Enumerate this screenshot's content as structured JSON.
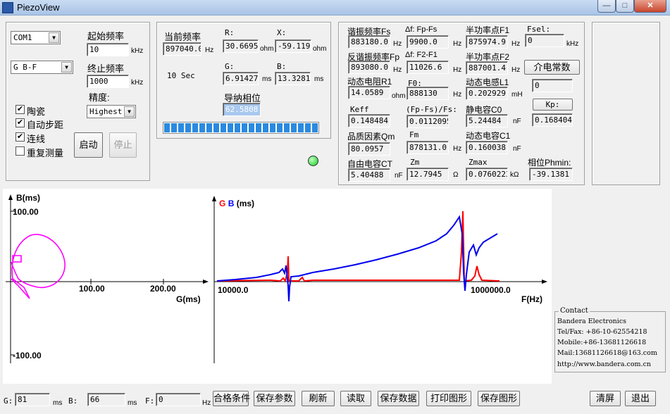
{
  "window": {
    "title": "PiezoView",
    "minimize": "—",
    "maximize": "□",
    "close": "✕"
  },
  "controls": {
    "port": "COM1",
    "mode": "G B-F",
    "start_freq_label": "起始频率",
    "start_freq_value": "10",
    "start_freq_unit": "kHz",
    "end_freq_label": "终止频率",
    "end_freq_value": "1000",
    "end_freq_unit": "kHz",
    "precision_label": "精度:",
    "precision_value": "Highest",
    "checkboxes": [
      {
        "label": "陶瓷",
        "checked": true
      },
      {
        "label": "自动步距",
        "checked": true
      },
      {
        "label": "连线",
        "checked": true
      },
      {
        "label": "重复测量",
        "checked": false
      }
    ],
    "start_button": "启动",
    "stop_button": "停止"
  },
  "measure": {
    "current_freq_label": "当前频率",
    "current_freq_value": "897040.0",
    "current_freq_unit": "Hz",
    "r_label": "R:",
    "r_value": "30.6695",
    "r_unit": "ohm",
    "x_label": "X:",
    "x_value": "-59.1191",
    "x_unit": "ohm",
    "time_text": "10 Sec",
    "g_label": "G:",
    "g_value": "6.91427",
    "g_unit": "ms",
    "b_label": "B:",
    "b_value": "13.3281",
    "b_unit": "ms",
    "phase_label": "导纳相位",
    "phase_value": "62.5808",
    "progress_percent": 100,
    "status_led_color": "#11cc22"
  },
  "params": {
    "fs_label": "谐振频率Fs",
    "fs_value": "883180.0",
    "fs_unit": "Hz",
    "df1_label": "Δf: Fp-Fs",
    "df1_value": "9900.0",
    "df1_unit": "Hz",
    "f1_label": "半功率点F1",
    "f1_value": "875974.9",
    "f1_unit": "Hz",
    "fsel_label": "Fsel:",
    "fsel_value": "0",
    "fsel_unit": "kHz",
    "fp_label": "反谐振频率Fp",
    "fp_value": "893080.0",
    "fp_unit": "Hz",
    "df2_label": "Δf: F2-F1",
    "df2_value": "11026.6",
    "df2_unit": "Hz",
    "f2_label": "半功率点F2",
    "f2_value": "887001.4",
    "f2_unit": "Hz",
    "dielectric_button": "介电常数",
    "dielectric_value": "0",
    "r1_label": "动态电阻R1",
    "r1_value": "14.0589",
    "r1_unit": "ohm",
    "f0_label": "F0:",
    "f0_value": "888130",
    "f0_unit": "Hz",
    "l1_label": "动态电感L1",
    "l1_value": "0.202929",
    "l1_unit": "mH",
    "kp_button": "Kp:",
    "kp_value": "0.168404",
    "keff_label": "Keff",
    "keff_value": "0.148484",
    "ratio_label": "(Fp-Fs)/Fs:",
    "ratio_value": "0.0112095",
    "c0_label": "静电容C0",
    "c0_value": "5.24484",
    "c0_unit": "nF",
    "qm_label": "品质因素Qm",
    "qm_value": "80.0957",
    "fm_label": "Fm",
    "fm_value": "878131.0",
    "fm_unit": "Hz",
    "c1_label": "动态电容C1",
    "c1_value": "0.160038",
    "c1_unit": "nF",
    "ct_label": "自由电容CT",
    "ct_value": "5.40488",
    "ct_unit": "nF",
    "zm_label": "Zm",
    "zm_value": "12.7945",
    "zm_unit": "Ω",
    "zmax_label": "Zmax",
    "zmax_value": "0.0760223",
    "zmax_unit": "kΩ",
    "phmin_label": "相位Phmin:",
    "phmin_value": "-39.1381"
  },
  "admittance_plot": {
    "ylabel": "B(ms)",
    "xlabel": "G(ms)",
    "y_top_tick": "100.00",
    "y_bottom_tick": "-100.00",
    "x_ticks": [
      "100.00",
      "200.00"
    ],
    "curve_color": "#ff00ff"
  },
  "spectrum_plot": {
    "ylabel_g": "G",
    "ylabel_b": "B",
    "ylabel_unit": "(ms)",
    "xlabel": "F(Hz)",
    "x_ticks": [
      "10000.0",
      "1000000.0"
    ],
    "g_color": "#ff0000",
    "b_color": "#0000ff"
  },
  "contact": {
    "title": "Contact",
    "lines": [
      "Bandera Electronics",
      "Tel/Fax: +86-10-62554218",
      "Mobile:+86-13681126618",
      "Mail:13681126618@163.com",
      "http://www.bandera.com.cn"
    ]
  },
  "bottom": {
    "g_label": "G:",
    "g_value": "81",
    "g_unit": "ms",
    "b_label": "B:",
    "b_value": "66",
    "b_unit": "ms",
    "f_label": "F:",
    "f_value": "0",
    "f_unit": "Hz",
    "buttons": [
      "合格条件",
      "保存参数",
      "刷新",
      "读取",
      "保存数据",
      "打印图形",
      "保存图形"
    ],
    "clear_button": "清屏",
    "exit_button": "退出"
  }
}
